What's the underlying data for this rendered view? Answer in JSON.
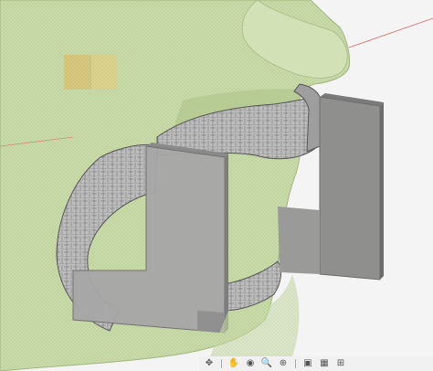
{
  "scene": {
    "model_name": "jaw mouthguard mesh",
    "colors": {
      "face_mesh": "#c9dba9",
      "face_shadow": "#a9bf86",
      "guard_mesh": "#bdbdbd",
      "guard_lines": "#555555",
      "plate_front": "#a7a7a7",
      "plate_back": "#8f8f8e",
      "plate_edge": "#6d6d6d",
      "background": "#f4f4f4",
      "axis_red": "#e06060",
      "view_cube": "#e8b14c"
    }
  },
  "navigation_bar": {
    "icons": [
      "orbit-icon",
      "pan-icon",
      "look-at-icon",
      "zoom-icon",
      "zoom-window-icon",
      "display-settings-icon",
      "grid-icon",
      "viewports-icon"
    ]
  }
}
